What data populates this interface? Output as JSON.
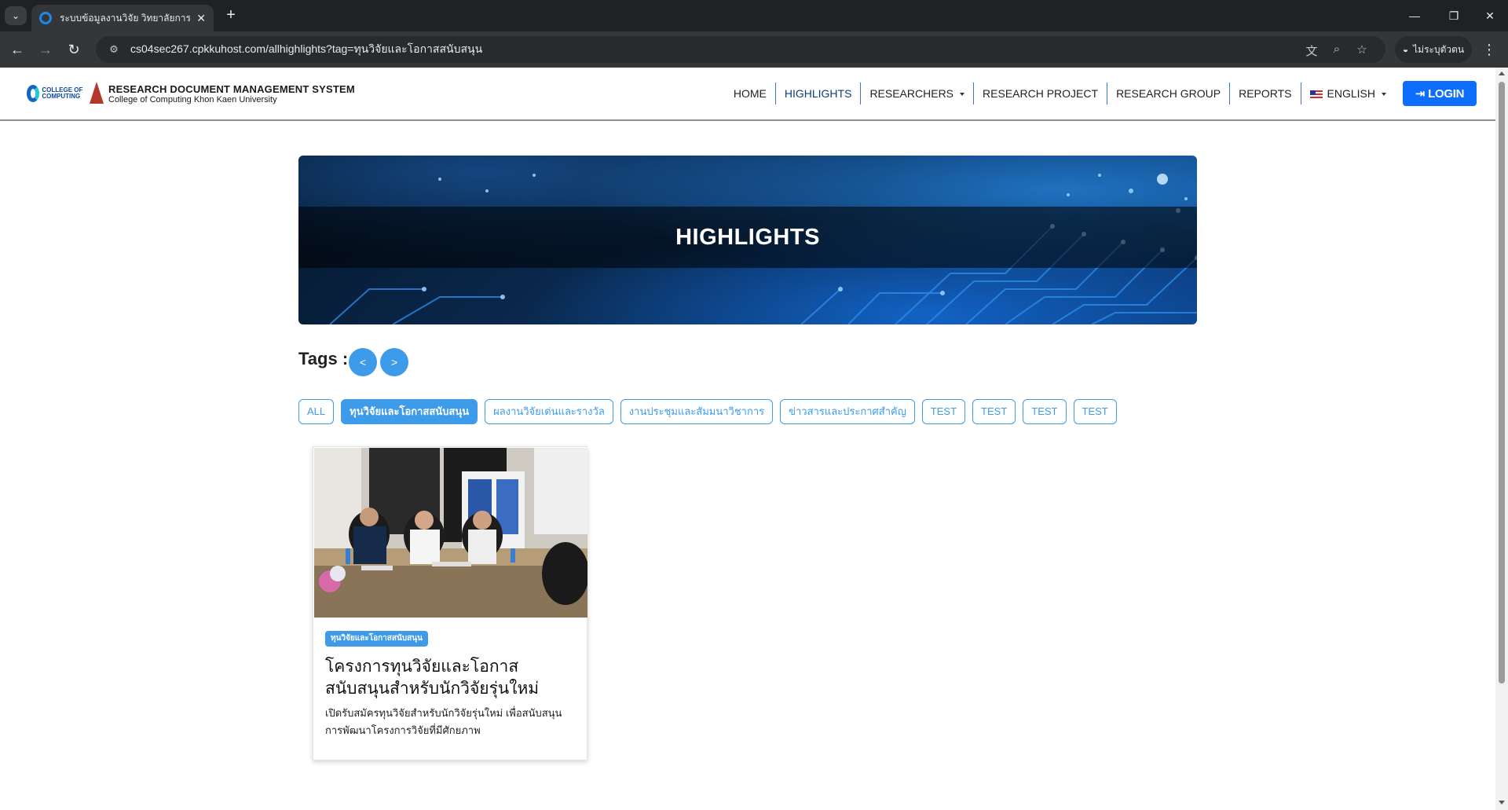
{
  "browser": {
    "tab_title": "ระบบข้อมูลงานวิจัย วิทยาลัยการคอม",
    "url": "cs04sec267.cpkkuhost.com/allhighlights?tag=ทุนวิจัยและโอกาสสนับสนุน",
    "profile_label": "ไม่ระบุตัวตน",
    "icons": [
      "tab-list-icon",
      "favicon",
      "close-icon",
      "plus-icon",
      "minimize-icon",
      "restore-icon",
      "close-window-icon",
      "back-icon",
      "forward-icon",
      "reload-icon",
      "site-info-icon",
      "translate-icon",
      "zoom-icon",
      "star-icon",
      "incognito-icon",
      "menu-icon"
    ]
  },
  "header": {
    "logo_text": "COLLEGE OF COMPUTING",
    "brand_title": "RESEARCH DOCUMENT MANAGEMENT SYSTEM",
    "brand_subtitle": "College of Computing Khon Kaen University",
    "nav": [
      {
        "label": "HOME"
      },
      {
        "label": "HIGHLIGHTS"
      },
      {
        "label": "RESEARCHERS"
      },
      {
        "label": "RESEARCH PROJECT"
      },
      {
        "label": "RESEARCH GROUP"
      },
      {
        "label": "REPORTS"
      },
      {
        "label": "ENGLISH"
      }
    ],
    "login_label": "LOGIN"
  },
  "banner": {
    "title": "HIGHLIGHTS"
  },
  "tags": {
    "label": "Tags :",
    "prev_label": "<",
    "next_label": ">",
    "items": [
      {
        "label": "ALL",
        "active": false
      },
      {
        "label": "ทุนวิจัยและโอกาสสนับสนุน",
        "active": true
      },
      {
        "label": "ผลงานวิจัยเด่นและรางวัล",
        "active": false
      },
      {
        "label": "งานประชุมและสัมมนาวิชาการ",
        "active": false
      },
      {
        "label": "ข่าวสารและประกาศสำคัญ",
        "active": false
      },
      {
        "label": "TEST",
        "active": false
      },
      {
        "label": "TEST",
        "active": false
      },
      {
        "label": "TEST",
        "active": false
      },
      {
        "label": "TEST",
        "active": false
      }
    ]
  },
  "card": {
    "badge": "ทุนวิจัยและโอกาสสนับสนุน",
    "title": "โครงการทุนวิจัยและโอกาสสนับสนุนสำหรับนักวิจัยรุ่นใหม่",
    "description": "เปิดรับสมัครทุนวิจัยสำหรับนักวิจัยรุ่นใหม่ เพื่อสนับสนุนการพัฒนาโครงการวิจัยที่มีศักยภาพ"
  },
  "colors": {
    "accent": "#3d9be9",
    "login": "#0d6efd",
    "nav_active": "#0d3c7a",
    "browser_dark": "#202124"
  }
}
